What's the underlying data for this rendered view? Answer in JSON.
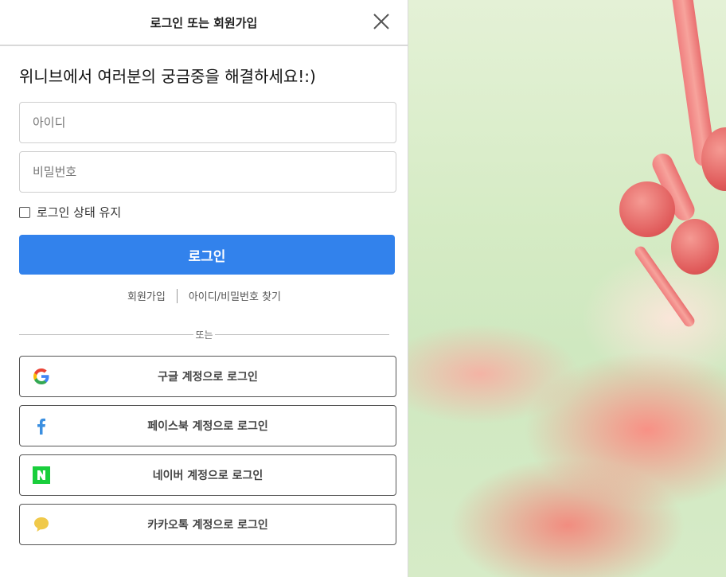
{
  "header": {
    "title": "로그인 또는 회원가입",
    "close_icon": "close-icon"
  },
  "welcome": "위니브에서 여러분의 궁금중을 해결하세요!:)",
  "form": {
    "id_placeholder": "아이디",
    "password_placeholder": "비밀번호",
    "keep_logged_in": "로그인 상태 유지",
    "keep_logged_in_checked": false,
    "login_button": "로그인"
  },
  "links": {
    "signup": "회원가입",
    "find": "아이디/비밀번호 찾기"
  },
  "divider": "또는",
  "social": [
    {
      "label": "구글 계정으로 로그인",
      "icon": "google-icon"
    },
    {
      "label": "페이스북 계정으로 로그인",
      "icon": "facebook-icon",
      "color": "#3b8fe0"
    },
    {
      "label": "네이버 계정으로 로그인",
      "icon": "naver-icon",
      "color": "#19ce3c"
    },
    {
      "label": "카카오톡 계정으로 로그인",
      "icon": "kakao-icon",
      "color": "#f0c94a"
    }
  ],
  "colors": {
    "primary": "#3282ec"
  }
}
